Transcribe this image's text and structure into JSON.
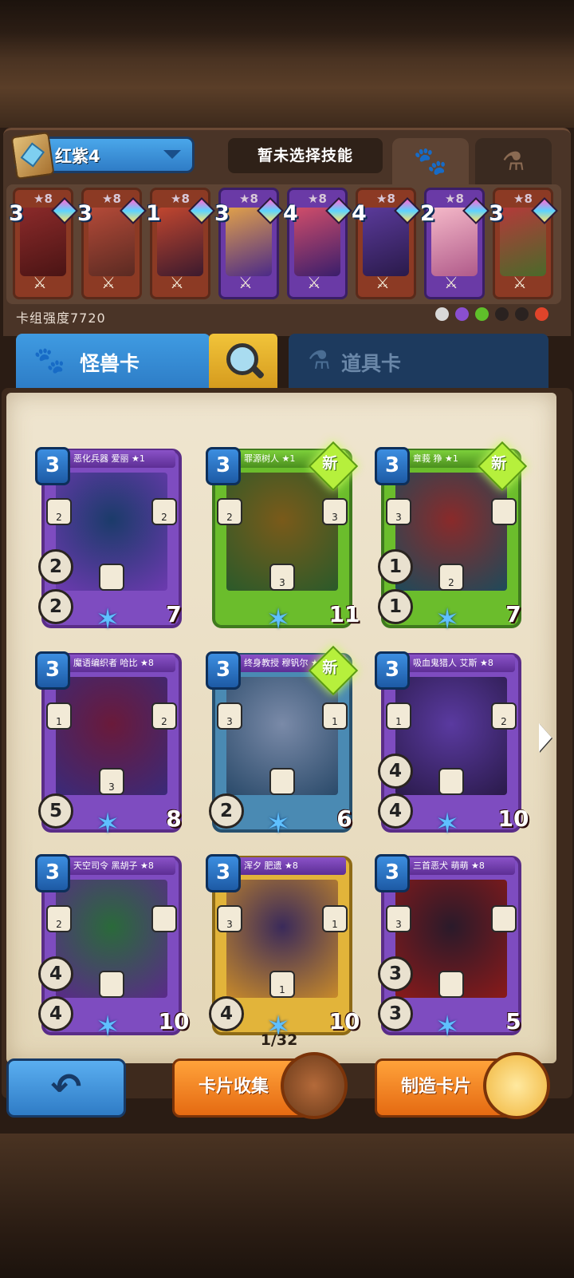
{
  "deck": {
    "name": "红紫4",
    "skill_label": "暂未选择技能",
    "power_label": "卡组强度7720",
    "mini_cards": [
      {
        "cost": "3",
        "stars": "★8",
        "frame": "red",
        "art": [
          "#8b2a2a",
          "#4a1414"
        ]
      },
      {
        "cost": "3",
        "stars": "★8",
        "frame": "red",
        "art": [
          "#b44a38",
          "#5a2a22"
        ]
      },
      {
        "cost": "1",
        "stars": "★8",
        "frame": "red",
        "art": [
          "#c0462f",
          "#3b1a2e"
        ]
      },
      {
        "cost": "3",
        "stars": "★8",
        "frame": "purple",
        "art": [
          "#e0a04a",
          "#4b2a88"
        ]
      },
      {
        "cost": "4",
        "stars": "★8",
        "frame": "purple",
        "art": [
          "#d04d6a",
          "#3a1e6b"
        ]
      },
      {
        "cost": "4",
        "stars": "★8",
        "frame": "red",
        "art": [
          "#5a3a9a",
          "#2a1a4a"
        ]
      },
      {
        "cost": "2",
        "stars": "★8",
        "frame": "purple",
        "art": [
          "#f4b8c8",
          "#b05a8a"
        ]
      },
      {
        "cost": "3",
        "stars": "★8",
        "frame": "red",
        "art": [
          "#b43a3a",
          "#4a6a2a"
        ]
      }
    ],
    "element_icons": [
      {
        "name": "neutral-icon",
        "color": "#d8d8d8"
      },
      {
        "name": "purple-element-icon",
        "color": "#8a4fd0"
      },
      {
        "name": "green-element-icon",
        "color": "#5fbf2a"
      },
      {
        "name": "dark-element-icon",
        "color": "#2a2220"
      },
      {
        "name": "dark-element-icon-2",
        "color": "#2a2220"
      },
      {
        "name": "fire-element-icon",
        "color": "#e0442a"
      }
    ]
  },
  "tabs": {
    "monster_label": "怪兽卡",
    "item_label": "道具卡"
  },
  "cards": [
    {
      "name": "恶化兵器 爱丽 ★1",
      "cost": "3",
      "frame": "purple",
      "is_new": false,
      "left_top": "2",
      "left_bottom": "2",
      "hp": "7",
      "socket_values": [
        "2",
        "",
        "2"
      ],
      "art": [
        "#6d3ab0",
        "#1b3b6a"
      ]
    },
    {
      "name": "罪源树人 ★1",
      "cost": "3",
      "frame": "green",
      "is_new": true,
      "left_top": "",
      "left_bottom": "",
      "hp": "11",
      "socket_values": [
        "2",
        "3",
        "3"
      ],
      "art": [
        "#2a5a2a",
        "#7a5a1a"
      ]
    },
    {
      "name": "章莪 狰 ★1",
      "cost": "3",
      "frame": "green",
      "is_new": true,
      "left_top": "1",
      "left_bottom": "1",
      "hp": "7",
      "socket_values": [
        "3",
        "2",
        ""
      ],
      "art": [
        "#1e4a5a",
        "#8a2a2a"
      ]
    },
    {
      "name": "魔语编织者 哈比 ★8",
      "cost": "3",
      "frame": "purple",
      "is_new": false,
      "left_top": "",
      "left_bottom": "5",
      "hp": "8",
      "socket_values": [
        "1",
        "3",
        "2"
      ],
      "art": [
        "#3a2a7a",
        "#6a1a3a"
      ]
    },
    {
      "name": "终身教授 穆钒尔 ★8",
      "cost": "3",
      "frame": "blue",
      "is_new": true,
      "left_top": "",
      "left_bottom": "2",
      "hp": "6",
      "socket_values": [
        "3",
        "",
        "1"
      ],
      "art": [
        "#2a4a6a",
        "#7a8aa8"
      ]
    },
    {
      "name": "吸血鬼猎人 艾斯 ★8",
      "cost": "3",
      "frame": "purple",
      "is_new": false,
      "left_top": "4",
      "left_bottom": "4",
      "hp": "10",
      "socket_values": [
        "1",
        "",
        "2"
      ],
      "art": [
        "#2a1a4a",
        "#5a3aa0"
      ]
    },
    {
      "name": "天空司令 黑胡子 ★8",
      "cost": "3",
      "frame": "purple",
      "is_new": false,
      "left_top": "4",
      "left_bottom": "4",
      "hp": "10",
      "socket_values": [
        "2",
        "",
        ""
      ],
      "art": [
        "#5a2a8a",
        "#2a6a3a"
      ]
    },
    {
      "name": "浑夕 肥遗 ★8",
      "cost": "3",
      "frame": "gold",
      "is_new": false,
      "left_top": "",
      "left_bottom": "4",
      "hp": "10",
      "socket_values": [
        "3",
        "1",
        "1"
      ],
      "art": [
        "#c88a2a",
        "#3a2a5a"
      ]
    },
    {
      "name": "三首恶犬 萌萌 ★8",
      "cost": "3",
      "frame": "purple",
      "is_new": false,
      "left_top": "3",
      "left_bottom": "3",
      "hp": "5",
      "socket_values": [
        "3",
        "",
        ""
      ],
      "art": [
        "#8a1a1a",
        "#2a1a2a"
      ]
    }
  ],
  "new_label": "新",
  "pagination": {
    "label": "1/32"
  },
  "buttons": {
    "back_label": "↶",
    "collection_label": "卡片收集",
    "craft_label": "制造卡片"
  }
}
